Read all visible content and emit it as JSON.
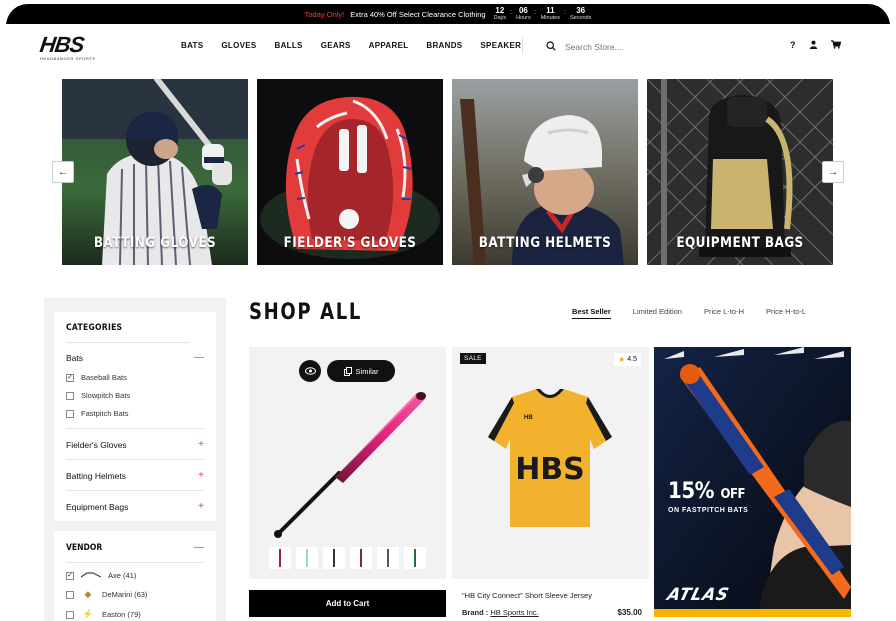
{
  "announcement": {
    "highlight": "Today Only!",
    "text": "Extra 40% Off Select Clearance Clothing",
    "countdown": [
      {
        "value": "12",
        "label": "Days"
      },
      {
        "value": "06",
        "label": "Hours"
      },
      {
        "value": "11",
        "label": "Minutes"
      },
      {
        "value": "36",
        "label": "Seconds"
      }
    ]
  },
  "header": {
    "logo_text": "HBS",
    "logo_sub": "HEADBANGER SPORTS",
    "nav": [
      "BATS",
      "GLOVES",
      "BALLS",
      "GEARS",
      "APPAREL",
      "BRANDS",
      "SPEAKER"
    ],
    "search_placeholder": "Search Store....",
    "help_label": "?"
  },
  "categories": [
    {
      "title": "BATTING GLOVES"
    },
    {
      "title": "FIELDER'S GLOVES"
    },
    {
      "title": "BATTING HELMETS"
    },
    {
      "title": "EQUIPMENT BAGS"
    }
  ],
  "sidebar": {
    "categories_title": "CATEGORIES",
    "bats_label": "Bats",
    "bats_items": [
      {
        "label": "Baseball Bats",
        "checked": true
      },
      {
        "label": "Slowpitch Bats",
        "checked": false
      },
      {
        "label": "Fastpitch Bats",
        "checked": false
      }
    ],
    "collapsed": [
      "Fielder's Gloves",
      "Batting Helmets",
      "Equipment Bags"
    ],
    "vendor_title": "VENDOR",
    "vendors": [
      {
        "label": "Axe (41)",
        "checked": true
      },
      {
        "label": "DeMarini (63)",
        "checked": false
      },
      {
        "label": "Easton (79)",
        "checked": false
      }
    ]
  },
  "shop": {
    "title": "SHOP ALL",
    "sorts": [
      "Best Seller",
      "Limited Edition",
      "Price L-to-H",
      "Price H-to-L"
    ],
    "active_sort": "Best Seller"
  },
  "product1": {
    "similar_label": "Similar",
    "add_to_cart": "Add to Cart"
  },
  "product2": {
    "badge": "SALE",
    "rating": "4.5",
    "name": "\"HB City Connect\" Short Sleeve Jersey",
    "brand_label": "Brand :",
    "brand": "HB Sports Inc.",
    "price": "$35.00",
    "shirt_text": "HBS"
  },
  "promo": {
    "percent": "15%",
    "off": "OFF",
    "subtitle": "ON FASTPITCH BATS",
    "brand": "ATLAS"
  },
  "colors": {
    "accent_red": "#e53935",
    "jersey_yellow": "#f3b22e",
    "bat_pink": "#e0217a",
    "promo_bg": "#0c1830",
    "promo_bat_orange": "#f26a1b"
  }
}
